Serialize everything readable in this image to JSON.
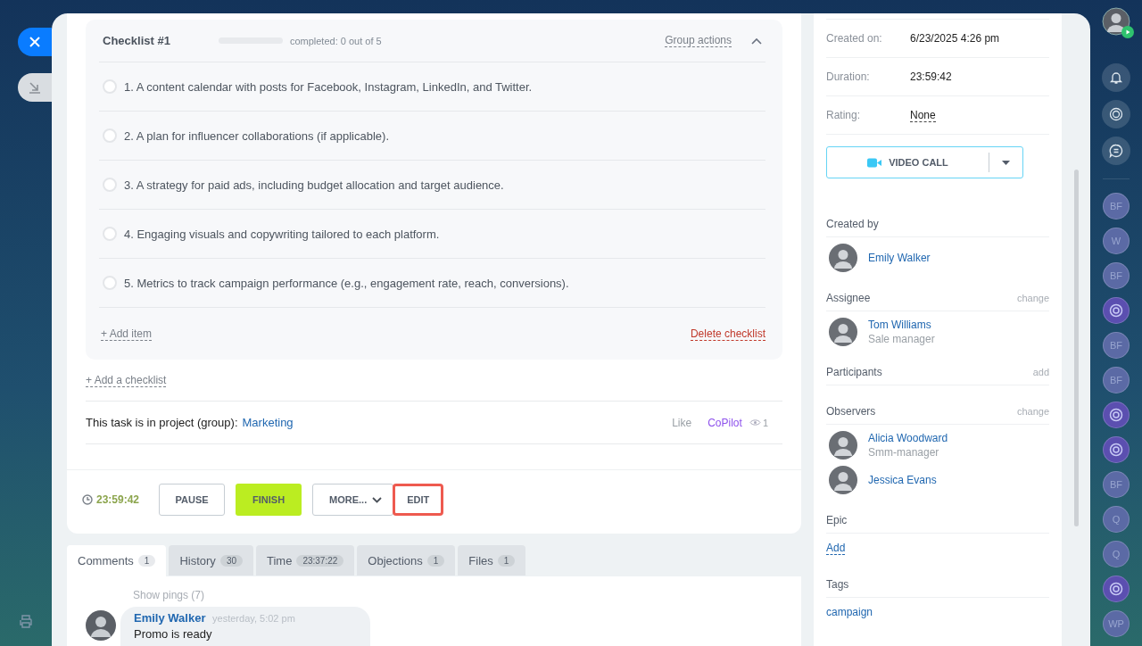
{
  "checklist": {
    "title": "Checklist #1",
    "level": 0,
    "progress_text": "completed: 0 out of 5",
    "group_actions": "Group actions",
    "expanded": true,
    "items": [
      {
        "text": "1. A content calendar with posts for Facebook, Instagram, LinkedIn, and Twitter.",
        "checked": false
      },
      {
        "text": "2. A plan for influencer collaborations (if applicable).",
        "checked": false
      },
      {
        "text": "3. A strategy for paid ads, including budget allocation and target audience.",
        "checked": false
      },
      {
        "text": "4. Engaging visuals and copywriting tailored to each platform.",
        "checked": false
      },
      {
        "text": "5. Metrics to track campaign performance (e.g., engagement rate, reach, conversions).",
        "checked": false
      }
    ],
    "add_item": "+ Add item",
    "delete": "Delete checklist"
  },
  "add_checklist": "+ Add a checklist",
  "project": {
    "label": "This task is in project (group):",
    "value": "Marketing",
    "like": "Like",
    "copilot": "CoPilot",
    "views": "1"
  },
  "timer": "23:59:42",
  "buttons": [
    {
      "label": "PAUSE",
      "kind": "outline",
      "highlighted": false
    },
    {
      "label": "FINISH",
      "kind": "primary",
      "highlighted": false
    },
    {
      "label": "MORE...",
      "kind": "dropdown",
      "highlighted": false
    },
    {
      "label": "EDIT",
      "kind": "plain",
      "highlighted": true
    }
  ],
  "tabs": [
    {
      "label": "Comments",
      "count": "1",
      "selected": true
    },
    {
      "label": "History",
      "count": "30",
      "selected": false
    },
    {
      "label": "Time",
      "count": "23:37:22",
      "selected": false
    },
    {
      "label": "Objections",
      "count": "1",
      "selected": false
    },
    {
      "label": "Files",
      "count": "1",
      "selected": false
    }
  ],
  "show_pings": "Show pings (7)",
  "comment": {
    "author": "Emily Walker",
    "time": "yesterday, 5:02 pm",
    "text": "Promo is ready"
  },
  "details": [
    {
      "label": "Created on:",
      "value": "6/23/2025 4:26 pm",
      "kind": "text"
    },
    {
      "label": "Duration:",
      "value": "23:59:42",
      "kind": "text"
    },
    {
      "label": "Rating:",
      "value": "None",
      "kind": "link"
    }
  ],
  "video_call": "VIDEO CALL",
  "people_sections": [
    {
      "title": "Created by",
      "people": [
        {
          "name": "Emily Walker"
        }
      ]
    },
    {
      "title": "Assignee",
      "action": "change",
      "people": [
        {
          "name": "Tom Williams",
          "role": "Sale manager"
        }
      ]
    },
    {
      "title": "Participants",
      "action": "add"
    },
    {
      "title": "Observers",
      "action": "change",
      "people": [
        {
          "name": "Alicia Woodward",
          "role": "Smm-manager"
        },
        {
          "name": "Jessica Evans"
        }
      ]
    }
  ],
  "epic": {
    "title": "Epic",
    "link": "Add"
  },
  "tags": {
    "title": "Tags",
    "items": [
      "campaign"
    ]
  },
  "right_rail": [
    {
      "kind": "user"
    },
    {
      "kind": "bell"
    },
    {
      "kind": "copilot"
    },
    {
      "kind": "chat"
    },
    {
      "kind": "divider"
    },
    {
      "kind": "initials",
      "text": "BF"
    },
    {
      "kind": "initials",
      "text": "W"
    },
    {
      "kind": "initials",
      "text": "BF"
    },
    {
      "kind": "copilot-chat"
    },
    {
      "kind": "initials",
      "text": "BF"
    },
    {
      "kind": "initials",
      "text": "BF"
    },
    {
      "kind": "copilot-chat"
    },
    {
      "kind": "copilot-chat"
    },
    {
      "kind": "initials",
      "text": "BF"
    },
    {
      "kind": "initials",
      "text": "Q"
    },
    {
      "kind": "initials",
      "text": "Q"
    },
    {
      "kind": "copilot-chat"
    },
    {
      "kind": "initials",
      "text": "WP"
    }
  ]
}
